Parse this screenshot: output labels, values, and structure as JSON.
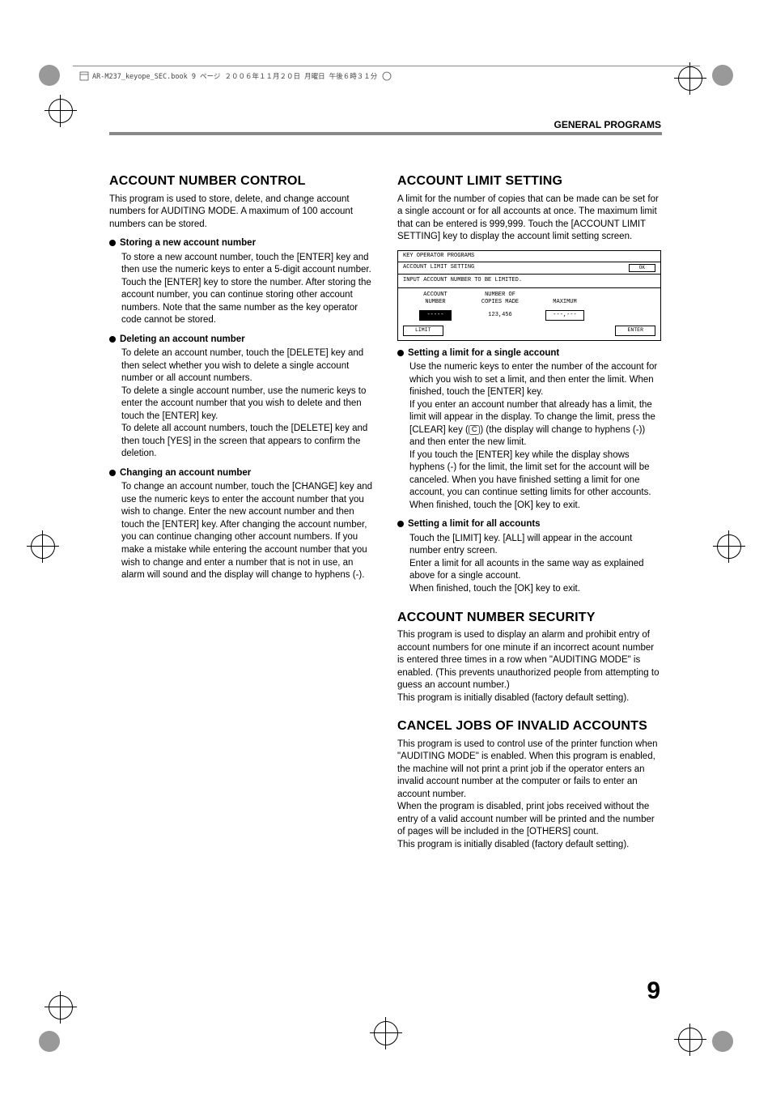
{
  "header_strip": "AR-M237_keyope_SEC.book  9 ページ  ２００６年１１月２０日  月曜日  午後６時３１分",
  "header_section": "GENERAL PROGRAMS",
  "page_number": "9",
  "left": {
    "h1": "ACCOUNT NUMBER CONTROL",
    "intro": "This program is used to store, delete, and change account numbers for AUDITING MODE. A maximum of 100 account numbers can be stored.",
    "b1_title": "Storing a new account number",
    "b1_body": "To store a new account number, touch the [ENTER] key and then use the numeric keys to enter a 5-digit account number. Touch the [ENTER] key to store the number. After storing the account number, you can continue storing other account numbers. Note that the same number as the key operator code cannot be stored.",
    "b2_title": "Deleting an account number",
    "b2_body": "To delete an account number, touch the [DELETE] key and then select whether you wish to delete a single account number or all account numbers.\nTo delete a single account number, use the numeric keys to enter the account number that you wish to delete and then touch the [ENTER] key.\nTo delete all account numbers, touch the [DELETE] key and then touch [YES] in the screen that appears to confirm the deletion.",
    "b3_title": "Changing an account number",
    "b3_body": "To change an account number, touch the [CHANGE] key and use the numeric keys to enter the account number that you wish to change. Enter the new account number and then touch the [ENTER] key. After changing the account number, you can continue changing other account numbers. If you make a mistake while entering the account number that you wish to change and enter a number that is not in use, an alarm will sound and the display will change to hyphens (-)."
  },
  "right": {
    "h1": "ACCOUNT LIMIT SETTING",
    "intro": "A limit for the number of copies that can be made can be set for a single account or for all accounts at once. The maximum limit that can be entered is 999,999. Touch the [ACCOUNT LIMIT SETTING] key to display the account limit setting screen.",
    "panel": {
      "title_top": "KEY OPERATOR PROGRAMS",
      "title_sub": "ACCOUNT LIMIT SETTING",
      "ok": "OK",
      "instr": "INPUT ACCOUNT NUMBER TO BE LIMITED.",
      "col1a": "ACCOUNT",
      "col1b": "NUMBER",
      "col2a": "NUMBER OF",
      "col2b": "COPIES MADE",
      "col3": "MAXIMUM",
      "v1": "-----",
      "v2": "123,456",
      "v3": "---,---",
      "btn_limit": "LIMIT",
      "btn_enter": "ENTER"
    },
    "b1_title": "Setting a limit for a single account",
    "b1_p1": "Use the numeric keys to enter the number of the account for which you wish to set a limit, and then enter the limit. When finished, touch the [ENTER] key.",
    "b1_p2a": "If you enter an account number that already has a limit, the limit will appear in the display. To change the limit, press the [CLEAR] key (",
    "b1_key": "C",
    "b1_p2b": ") (the display will change to hyphens (-)) and then enter the new limit.",
    "b1_p3": "If you touch the [ENTER] key while the display shows hyphens (-) for the limit, the limit set for the account will be canceled. When you have finished setting a limit for one account, you can continue setting limits for other accounts.",
    "b1_p4": "When finished, touch the [OK] key to exit.",
    "b2_title": "Setting a limit for all accounts",
    "b2_p1": "Touch the [LIMIT] key. [ALL] will appear in the account number entry screen.",
    "b2_p2": "Enter a limit for all acounts in the same way as explained above for a single account.",
    "b2_p3": "When finished, touch the [OK] key to exit.",
    "h2": "ACCOUNT NUMBER SECURITY",
    "sec_p1": "This program is used to display an alarm and prohibit entry of account numbers for one minute if an incorrect acount number is entered three times in a row when \"AUDITING MODE\" is enabled. (This prevents unauthorized people from attempting to guess an account number.)",
    "sec_p2": "This program is initially disabled (factory default setting).",
    "h3": "CANCEL JOBS OF INVALID ACCOUNTS",
    "cj_p1": "This program is used to control use of the printer function when \"AUDITING MODE\" is enabled. When this program is enabled, the machine will not print a print job if the operator enters an invalid account number at the computer or fails to enter an account number.",
    "cj_p2": "When the program is disabled, print jobs received without the entry of a valid account number will be printed and the number of pages will be included in the [OTHERS] count.",
    "cj_p3": "This program is initially disabled (factory default setting)."
  }
}
